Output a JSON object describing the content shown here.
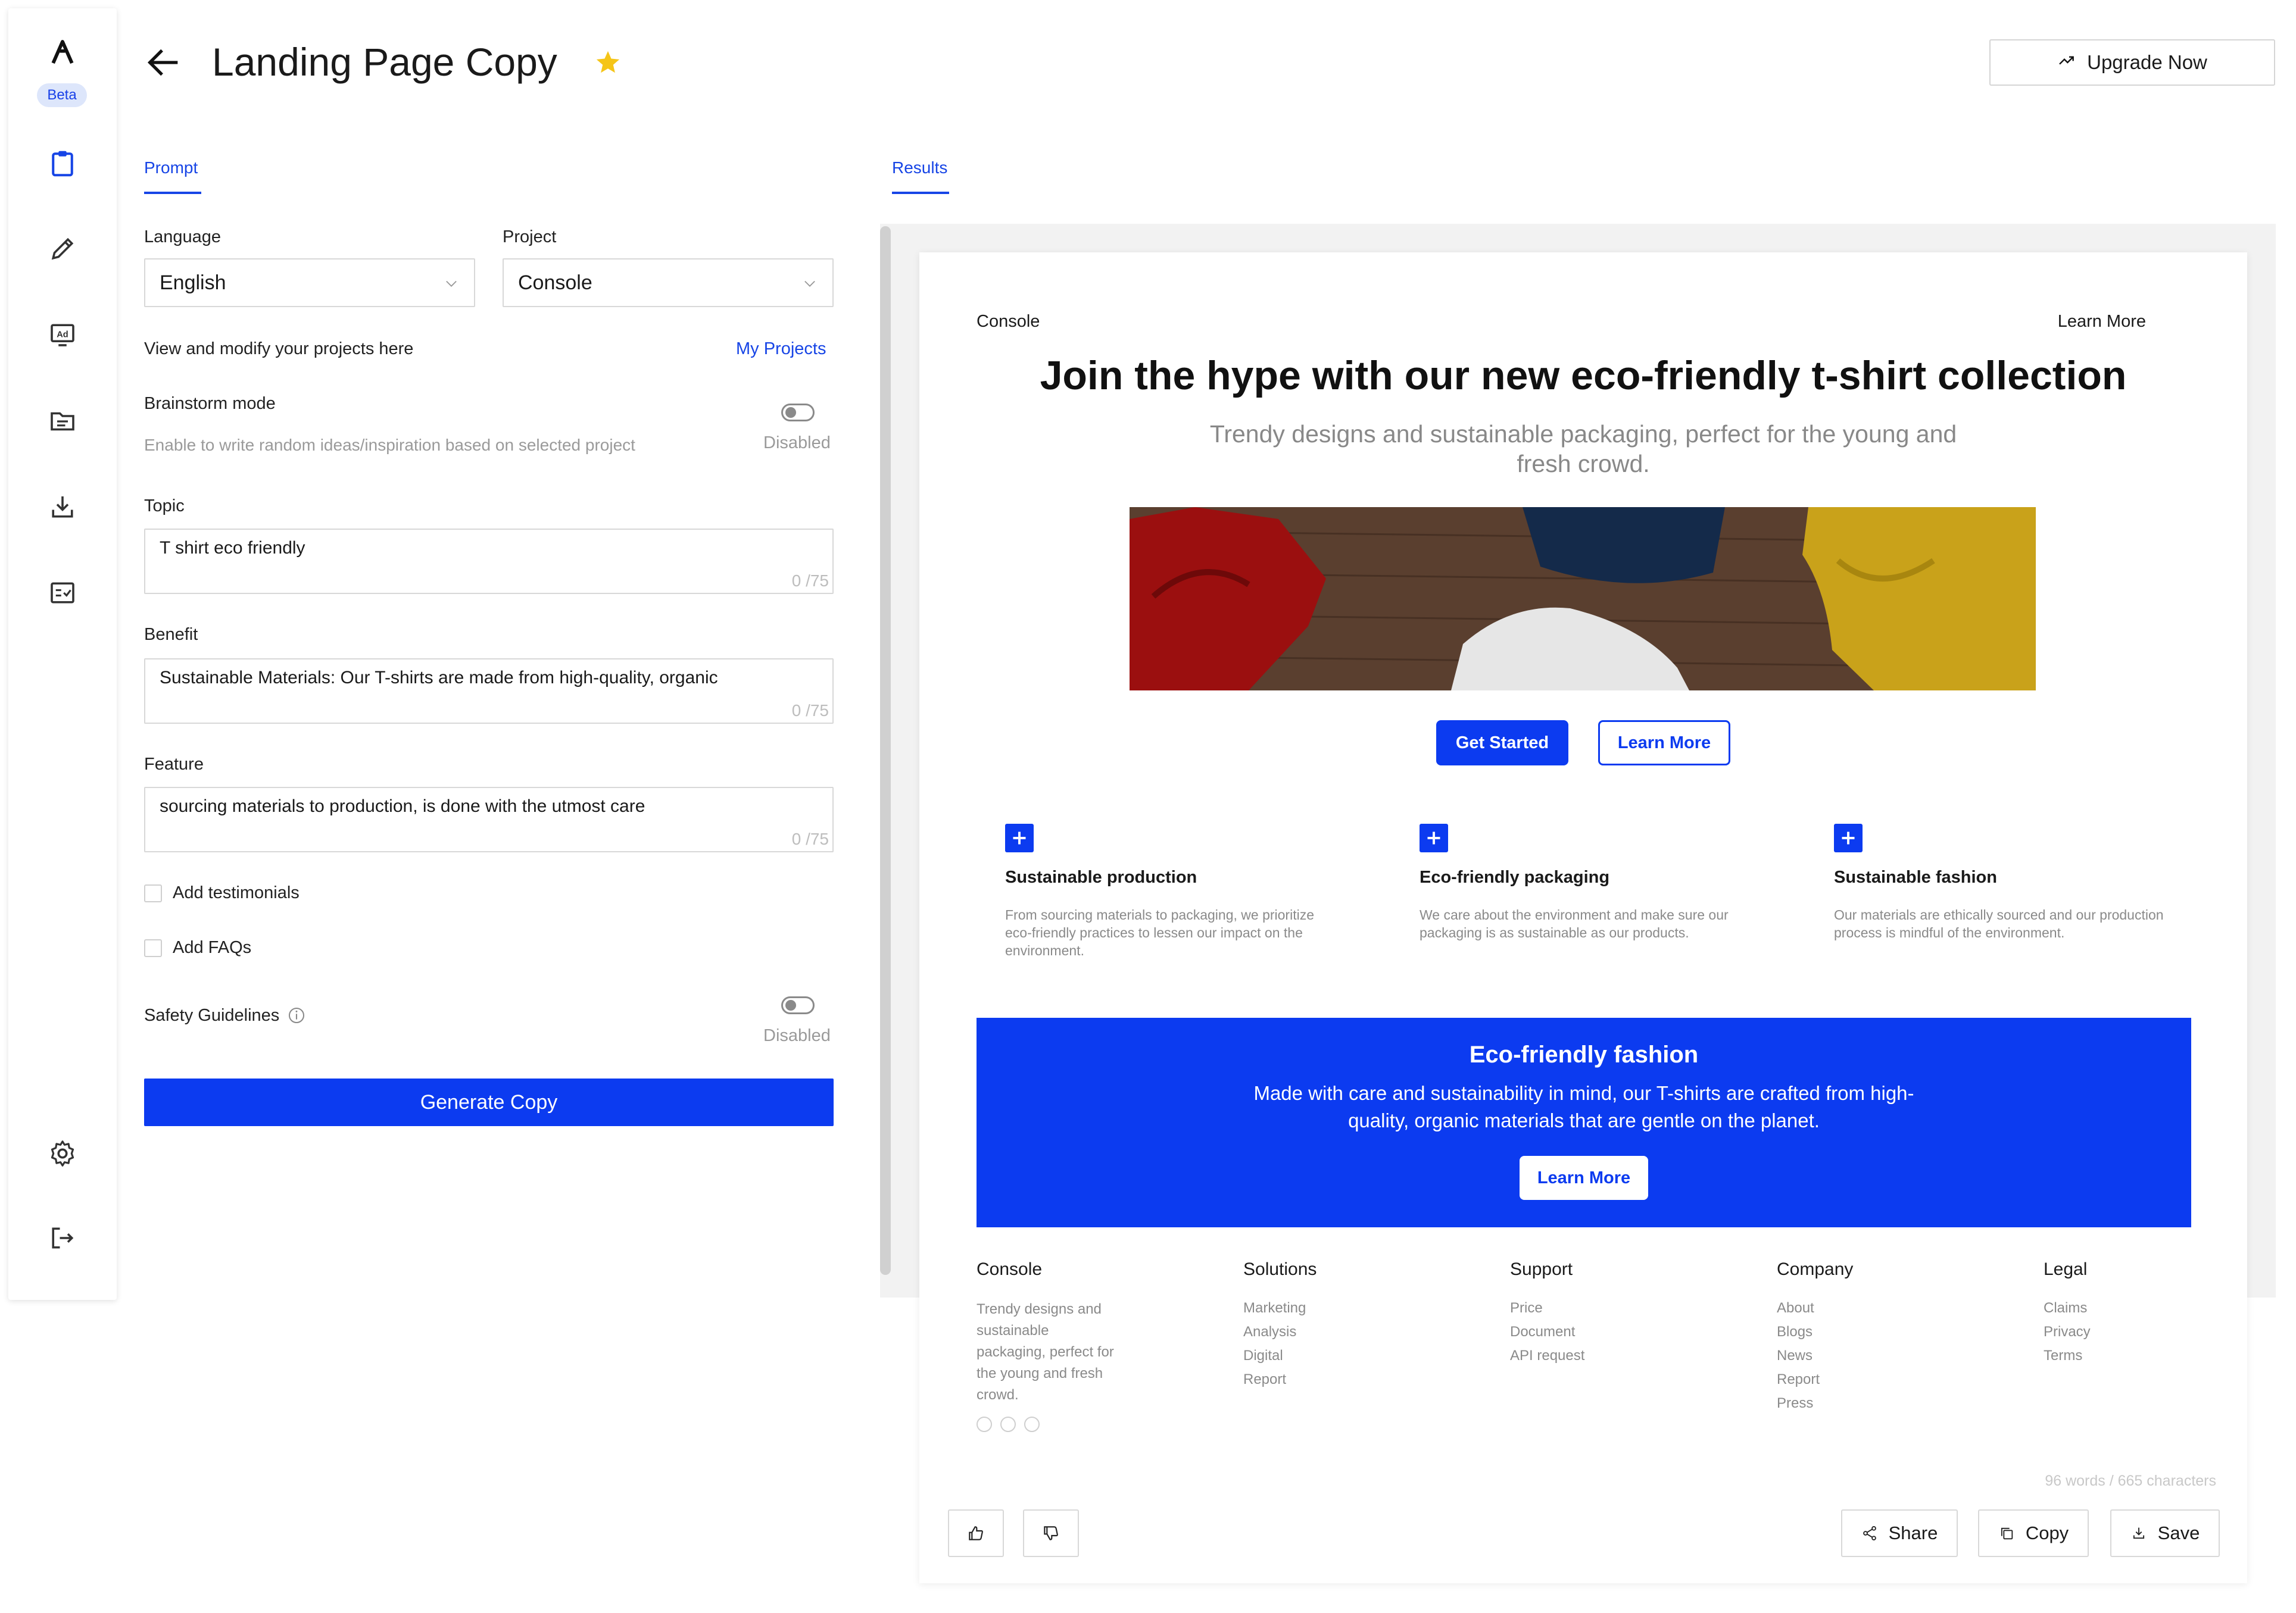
{
  "sidebar": {
    "beta_badge": "Beta",
    "icons": [
      "logo-icon",
      "clipboard-icon",
      "pencil-icon",
      "ad-icon",
      "folder-icon",
      "download-icon",
      "checklist-icon",
      "settings-icon",
      "logout-icon"
    ]
  },
  "header": {
    "title": "Landing Page Copy",
    "upgrade_label": "Upgrade Now"
  },
  "tabs": {
    "prompt": "Prompt",
    "results": "Results"
  },
  "form": {
    "language_label": "Language",
    "language_value": "English",
    "project_label": "Project",
    "project_value": "Console",
    "projects_hint": "View and modify your projects here",
    "my_projects_link": "My Projects",
    "brainstorm_label": "Brainstorm mode",
    "brainstorm_desc": "Enable to write random ideas/inspiration based on selected project",
    "brainstorm_state": "Disabled",
    "topic_label": "Topic",
    "topic_value": "T shirt eco friendly",
    "topic_counter": "0 /75",
    "benefit_label": "Benefit",
    "benefit_value": "Sustainable Materials: Our T-shirts are made from high-quality, organic",
    "benefit_counter": "0 /75",
    "feature_label": "Feature",
    "feature_value": "sourcing materials to production, is done with the utmost care",
    "feature_counter": "0 /75",
    "testimonials_label": "Add testimonials",
    "faqs_label": "Add FAQs",
    "safety_label": "Safety Guidelines",
    "safety_state": "Disabled",
    "generate_label": "Generate Copy"
  },
  "result": {
    "nav_brand": "Console",
    "nav_link": "Learn More",
    "hero_title": "Join the hype with our new eco-friendly t-shirt collection",
    "hero_subtitle": "Trendy designs and sustainable packaging, perfect for the young and fresh crowd.",
    "cta_primary": "Get Started",
    "cta_secondary": "Learn More",
    "features": [
      {
        "title": "Sustainable production",
        "desc": "From sourcing materials to packaging, we prioritize eco-friendly practices to lessen our impact on the environment."
      },
      {
        "title": "Eco-friendly packaging",
        "desc": "We care about the environment and make sure our packaging is as sustainable as our products."
      },
      {
        "title": "Sustainable fashion",
        "desc": "Our materials are ethically sourced and our production process is mindful of the environment."
      }
    ],
    "banner": {
      "title": "Eco-friendly fashion",
      "text": "Made with care and sustainability in mind, our T-shirts are crafted from high-quality, organic materials that are gentle on the planet.",
      "button": "Learn More"
    },
    "footer": {
      "brand": "Console",
      "brand_desc": "Trendy designs and sustainable packaging, perfect for the young and fresh crowd.",
      "columns": [
        {
          "head": "Solutions",
          "links": [
            "Marketing",
            "Analysis",
            "Digital",
            "Report"
          ]
        },
        {
          "head": "Support",
          "links": [
            "Price",
            "Document",
            "API request"
          ]
        },
        {
          "head": "Company",
          "links": [
            "About",
            "Blogs",
            "News",
            "Report",
            "Press"
          ]
        },
        {
          "head": "Legal",
          "links": [
            "Claims",
            "Privacy",
            "Terms"
          ]
        }
      ]
    },
    "word_count": "96 words / 665 characters",
    "share_label": "Share",
    "copy_label": "Copy",
    "save_label": "Save"
  },
  "colors": {
    "accent": "#0c3bf0",
    "star": "#f5c518"
  }
}
